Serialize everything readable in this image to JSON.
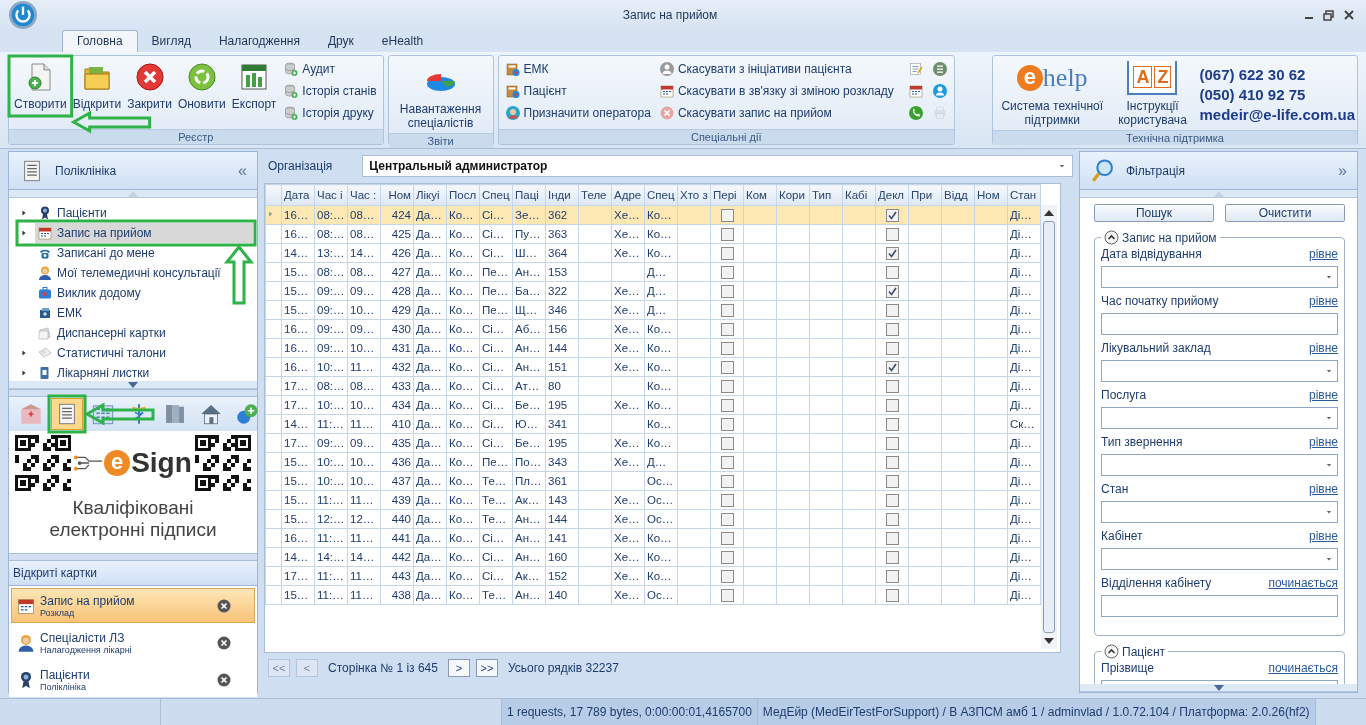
{
  "window": {
    "title": "Запис на прийом"
  },
  "ribbon": {
    "tabs": [
      {
        "label": "Головна",
        "selected": true
      },
      {
        "label": "Вигляд",
        "selected": false
      },
      {
        "label": "Налагодження",
        "selected": false
      },
      {
        "label": "Друк",
        "selected": false
      },
      {
        "label": "eHealth",
        "selected": false
      }
    ],
    "groups": [
      {
        "caption": "Реєстр",
        "items": [
          {
            "kind": "large",
            "label": "Створити"
          },
          {
            "kind": "large",
            "label": "Відкрити"
          },
          {
            "kind": "large",
            "label": "Закрити"
          },
          {
            "kind": "large",
            "label": "Оновити"
          },
          {
            "kind": "large",
            "label": "Експорт"
          },
          {
            "kind": "small",
            "label": "Аудит"
          },
          {
            "kind": "small",
            "label": "Історія станів"
          },
          {
            "kind": "small",
            "label": "Історія друку"
          }
        ]
      },
      {
        "caption": "Звіти",
        "items": [
          {
            "kind": "large",
            "label": "Навантаження спеціалістів"
          }
        ]
      },
      {
        "caption": "Спеціальні дії",
        "items": [
          {
            "kind": "small",
            "label": "ЕМК"
          },
          {
            "kind": "small",
            "label": "Пацієнт"
          },
          {
            "kind": "small",
            "label": "Призначити оператора"
          },
          {
            "kind": "small",
            "label": "Скасувати з ініціативи пацієнта"
          },
          {
            "kind": "small",
            "label": "Скасувати в зв'язку зі зміною розкладу"
          },
          {
            "kind": "small",
            "label": "Скасувати запис на прийом"
          },
          {
            "kind": "icon",
            "disabled": false
          },
          {
            "kind": "icon",
            "disabled": false
          },
          {
            "kind": "icon",
            "disabled": false
          },
          {
            "kind": "icon",
            "disabled": false
          },
          {
            "kind": "icon",
            "disabled": false
          },
          {
            "kind": "icon",
            "disabled": true
          }
        ]
      }
    ],
    "support": {
      "caption": "Технічна підтримка",
      "logo": {
        "mark": "e",
        "text": "help"
      },
      "book_letters": [
        "A",
        "Z"
      ],
      "links": [
        "Система технічної підтримки",
        "Інструкції користувача"
      ],
      "contacts": [
        "(067) 622 30 62",
        "(050) 410 92 75",
        "medeir@e-life.com.ua"
      ]
    }
  },
  "left_panel": {
    "title": "Поліклініка",
    "collapse": "«",
    "nav": [
      {
        "label": "Пацієнти",
        "expandable": true,
        "selected": false
      },
      {
        "label": "Запис на прийом",
        "expandable": true,
        "selected": true
      },
      {
        "label": "Записані до мене",
        "expandable": false,
        "selected": false
      },
      {
        "label": "Мої телемедичні консультації",
        "expandable": false,
        "selected": false
      },
      {
        "label": "Виклик додому",
        "expandable": false,
        "selected": false
      },
      {
        "label": "ЕМК",
        "expandable": false,
        "selected": false
      },
      {
        "label": "Диспансерні картки",
        "expandable": false,
        "selected": false
      },
      {
        "label": "Статистичні талони",
        "expandable": true,
        "selected": false
      },
      {
        "label": "Лікарняні листки",
        "expandable": true,
        "selected": false
      }
    ],
    "toolbar": [
      {
        "selected": false
      },
      {
        "selected": true
      },
      {
        "selected": false
      },
      {
        "selected": false
      },
      {
        "selected": false
      },
      {
        "selected": false
      },
      {
        "selected": false
      }
    ],
    "banner": {
      "logo_mark": "e",
      "logo_text": "Sign",
      "text": "Кваліфіковані електронні підписи"
    },
    "open_cards": {
      "title": "Відкриті картки",
      "items": [
        {
          "title": "Запис на прийом",
          "subtitle": "Розклад",
          "selected": true
        },
        {
          "title": "Спеціалісти ЛЗ",
          "subtitle": "Налагодження лікарні",
          "selected": false
        },
        {
          "title": "Пацієнти",
          "subtitle": "Поліклініка",
          "selected": false
        }
      ]
    }
  },
  "organization": {
    "label": "Організація",
    "value": "Центральный администратор"
  },
  "table": {
    "columns": [
      {
        "label": "Дата",
        "kind": "text"
      },
      {
        "label": "Час і",
        "kind": "text"
      },
      {
        "label": "Час :",
        "kind": "text"
      },
      {
        "label": "Ном",
        "kind": "number"
      },
      {
        "label": "Лікуі",
        "kind": "text"
      },
      {
        "label": "Посл",
        "kind": "text"
      },
      {
        "label": "Спец",
        "kind": "text"
      },
      {
        "label": "Паці",
        "kind": "text"
      },
      {
        "label": "Інди",
        "kind": "text"
      },
      {
        "label": "Теле",
        "kind": "text"
      },
      {
        "label": "Адре",
        "kind": "text"
      },
      {
        "label": "Спец",
        "kind": "text"
      },
      {
        "label": "Хто з",
        "kind": "text"
      },
      {
        "label": "Пері",
        "kind": "check"
      },
      {
        "label": "Ком",
        "kind": "text"
      },
      {
        "label": "Кори",
        "kind": "text"
      },
      {
        "label": "Тип",
        "kind": "text"
      },
      {
        "label": "Кабі",
        "kind": "text"
      },
      {
        "label": "Декл",
        "kind": "check"
      },
      {
        "label": "При",
        "kind": "text"
      },
      {
        "label": "Відд",
        "kind": "text"
      },
      {
        "label": "Ном",
        "kind": "text"
      },
      {
        "label": "Стан",
        "kind": "text"
      }
    ],
    "rows": [
      {
        "selected": true,
        "cells": [
          "16…",
          "08:…",
          "08…",
          "424",
          "Да…",
          "Ко…",
          "Сі…",
          "Зе…",
          "362",
          null,
          "Хе…",
          "Ко…",
          null,
          false,
          null,
          null,
          null,
          null,
          true,
          null,
          null,
          null,
          "Ді…"
        ]
      },
      {
        "selected": false,
        "cells": [
          "16…",
          "08:…",
          "08…",
          "425",
          "Да…",
          "Ко…",
          "Сі…",
          "Пу…",
          "363",
          null,
          "Хе…",
          "Ко…",
          null,
          false,
          null,
          null,
          null,
          null,
          false,
          null,
          null,
          null,
          "Ді…"
        ]
      },
      {
        "selected": false,
        "cells": [
          "14…",
          "13:…",
          "14…",
          "426",
          "Да…",
          "Ко…",
          "Сі…",
          "Ш…",
          "364",
          null,
          "Хе…",
          "Ко…",
          null,
          false,
          null,
          null,
          null,
          null,
          true,
          null,
          null,
          null,
          "Ді…"
        ]
      },
      {
        "selected": false,
        "cells": [
          "15…",
          "08:…",
          "08…",
          "427",
          "Да…",
          "Ко…",
          "Пе…",
          "Ан…",
          "153",
          null,
          null,
          "Д…",
          null,
          false,
          null,
          null,
          null,
          null,
          false,
          null,
          null,
          null,
          "Ді…"
        ]
      },
      {
        "selected": false,
        "cells": [
          "15…",
          "09:…",
          "09…",
          "428",
          "Да…",
          "Ко…",
          "Пе…",
          "Ба…",
          "322",
          null,
          "Хе…",
          "Д…",
          null,
          false,
          null,
          null,
          null,
          null,
          true,
          null,
          null,
          null,
          "Ді…"
        ]
      },
      {
        "selected": false,
        "cells": [
          "15…",
          "09:…",
          "10…",
          "429",
          "Да…",
          "Ко…",
          "Пе…",
          "Щ…",
          "346",
          null,
          "Хе…",
          "Д…",
          null,
          false,
          null,
          null,
          null,
          null,
          false,
          null,
          null,
          null,
          "Ді…"
        ]
      },
      {
        "selected": false,
        "cells": [
          "16…",
          "09:…",
          "09…",
          "430",
          "Да…",
          "Ко…",
          "Сі…",
          "Аб…",
          "156",
          null,
          "Хе…",
          "Ко…",
          null,
          false,
          null,
          null,
          null,
          null,
          false,
          null,
          null,
          null,
          "Ді…"
        ]
      },
      {
        "selected": false,
        "cells": [
          "16…",
          "09:…",
          "10…",
          "431",
          "Да…",
          "Ко…",
          "Сі…",
          "Ан…",
          "144",
          null,
          "Хе…",
          "Ко…",
          null,
          false,
          null,
          null,
          null,
          null,
          false,
          null,
          null,
          null,
          "Ді…"
        ]
      },
      {
        "selected": false,
        "cells": [
          "16…",
          "10:…",
          "11…",
          "432",
          "Да…",
          "Ко…",
          "Сі…",
          "Ан…",
          "151",
          null,
          "Хе…",
          "Ко…",
          null,
          false,
          null,
          null,
          null,
          null,
          true,
          null,
          null,
          null,
          "Ді…"
        ]
      },
      {
        "selected": false,
        "cells": [
          "17…",
          "08:…",
          "08…",
          "433",
          "Да…",
          "Ко…",
          "Сі…",
          "Ат…",
          "80",
          null,
          null,
          "Ко…",
          null,
          false,
          null,
          null,
          null,
          null,
          false,
          null,
          null,
          null,
          "Ді…"
        ]
      },
      {
        "selected": false,
        "cells": [
          "17…",
          "10:…",
          "10…",
          "434",
          "Да…",
          "Ко…",
          "Сі…",
          "Бе…",
          "195",
          null,
          "Хе…",
          "Ко…",
          null,
          false,
          null,
          null,
          null,
          null,
          false,
          null,
          null,
          null,
          "Ді…"
        ]
      },
      {
        "selected": false,
        "cells": [
          "14…",
          "11:…",
          "11…",
          "410",
          "Да…",
          "Ко…",
          "Сі…",
          "Ю…",
          "341",
          null,
          null,
          "Ко…",
          null,
          false,
          null,
          null,
          null,
          null,
          false,
          null,
          null,
          null,
          "Ск…"
        ]
      },
      {
        "selected": false,
        "cells": [
          "17…",
          "09:…",
          "09…",
          "435",
          "Да…",
          "Ко…",
          "Сі…",
          "Бе…",
          "195",
          null,
          "Хе…",
          "Ко…",
          null,
          false,
          null,
          null,
          null,
          null,
          false,
          null,
          null,
          null,
          "Ді…"
        ]
      },
      {
        "selected": false,
        "cells": [
          "15…",
          "10:…",
          "10…",
          "436",
          "Да…",
          "Ко…",
          "Пе…",
          "По…",
          "343",
          null,
          "Хе…",
          "Д…",
          null,
          false,
          null,
          null,
          null,
          null,
          false,
          null,
          null,
          null,
          "Ді…"
        ]
      },
      {
        "selected": false,
        "cells": [
          "15…",
          "10:…",
          "10…",
          "437",
          "Да…",
          "Ко…",
          "Те…",
          "Пл…",
          "361",
          null,
          null,
          "Ос…",
          null,
          false,
          null,
          null,
          null,
          null,
          false,
          null,
          null,
          null,
          "Ді…"
        ]
      },
      {
        "selected": false,
        "cells": [
          "15…",
          "11:…",
          "11…",
          "439",
          "Да…",
          "Ко…",
          "Те…",
          "Ак…",
          "143",
          null,
          "Хе…",
          "Ос…",
          null,
          false,
          null,
          null,
          null,
          null,
          false,
          null,
          null,
          null,
          "Ді…"
        ]
      },
      {
        "selected": false,
        "cells": [
          "15…",
          "12:…",
          "12…",
          "440",
          "Да…",
          "Ко…",
          "Те…",
          "Ан…",
          "144",
          null,
          "Хе…",
          "Ос…",
          null,
          false,
          null,
          null,
          null,
          null,
          false,
          null,
          null,
          null,
          "Ді…"
        ]
      },
      {
        "selected": false,
        "cells": [
          "16…",
          "11:…",
          "11…",
          "441",
          "Да…",
          "Ко…",
          "Сі…",
          "Ан…",
          "141",
          null,
          "Хе…",
          "Ко…",
          null,
          false,
          null,
          null,
          null,
          null,
          false,
          null,
          null,
          null,
          "Ді…"
        ]
      },
      {
        "selected": false,
        "cells": [
          "14…",
          "14:…",
          "14…",
          "442",
          "Да…",
          "Ко…",
          "Сі…",
          "Ан…",
          "160",
          null,
          "Хе…",
          "Ко…",
          null,
          false,
          null,
          null,
          null,
          null,
          false,
          null,
          null,
          null,
          "Ді…"
        ]
      },
      {
        "selected": false,
        "cells": [
          "17…",
          "11:…",
          "11…",
          "443",
          "Да…",
          "Ко…",
          "Сі…",
          "Ак…",
          "152",
          null,
          "Хе…",
          "Ко…",
          null,
          false,
          null,
          null,
          null,
          null,
          false,
          null,
          null,
          null,
          "Ді…"
        ]
      },
      {
        "selected": false,
        "cells": [
          "15…",
          "11:…",
          "11…",
          "438",
          "Да…",
          "Ко…",
          "Те…",
          "Ан…",
          "140",
          null,
          "Хе…",
          "Ос…",
          null,
          false,
          null,
          null,
          null,
          null,
          false,
          null,
          null,
          null,
          "Ді…"
        ]
      }
    ]
  },
  "pager": {
    "buttons": [
      {
        "label": "<<",
        "disabled": true
      },
      {
        "label": "<",
        "disabled": true
      }
    ],
    "page": "Сторінка № 1 із 645",
    "next_buttons": [
      {
        "label": ">",
        "disabled": false
      },
      {
        "label": ">>",
        "disabled": false
      }
    ],
    "total": "Усього рядків 32237"
  },
  "filter_panel": {
    "title": "Фільтрація",
    "collapse": "»",
    "buttons": [
      "Пошук",
      "Очистити"
    ],
    "groups": [
      {
        "title": "Запис на прийом",
        "expanded": true,
        "fields": [
          {
            "label": "Дата відвідування",
            "operator": "рівне",
            "kind": "combo"
          },
          {
            "label": "Час початку прийому",
            "operator": "рівне",
            "kind": "text"
          },
          {
            "label": "Лікувальний заклад",
            "operator": "рівне",
            "kind": "combo"
          },
          {
            "label": "Послуга",
            "operator": "рівне",
            "kind": "combo"
          },
          {
            "label": "Тип звернення",
            "operator": "рівне",
            "kind": "combo"
          },
          {
            "label": "Стан",
            "operator": "рівне",
            "kind": "combo"
          },
          {
            "label": "Кабінет",
            "operator": "рівне",
            "kind": "combo"
          },
          {
            "label": "Відділення кабінету",
            "operator": "починається",
            "kind": "text"
          }
        ]
      },
      {
        "title": "Пацієнт",
        "expanded": true,
        "fields": [
          {
            "label": "Прізвище",
            "operator": "починається",
            "kind": "text"
          }
        ]
      }
    ]
  },
  "status_bar": {
    "segments": [
      "1 requests, 17 789 bytes, 0:00:00:01,4165700",
      "МедЕйр (MedEirTestForSupport) / В АЗПСМ амб 1 / adminvlad / 1.0.72.104 / Платформа: 2.0.26(hf2)"
    ]
  },
  "annotations": [
    {
      "kind": "frame"
    },
    {
      "kind": "arrow"
    },
    {
      "kind": "frame"
    },
    {
      "kind": "arrow"
    },
    {
      "kind": "frame"
    },
    {
      "kind": "arrow"
    }
  ]
}
